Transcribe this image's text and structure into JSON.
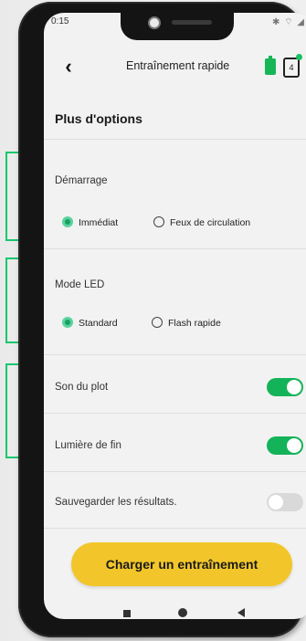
{
  "status_bar": {
    "time": "0:15",
    "icons": "✱ ⌔ ◢"
  },
  "header": {
    "back_icon": "back-chevron-icon",
    "title": "Entraînement rapide",
    "battery_icon": "battery-icon",
    "count": "4",
    "accent": "#16b657"
  },
  "section_title": "Plus d'options",
  "demarrage": {
    "label": "Démarrage",
    "options": [
      "Immédiat",
      "Feux de circulation"
    ],
    "selected": "Immédiat"
  },
  "mode_led": {
    "label": "Mode LED",
    "options": [
      "Standard",
      "Flash rapide"
    ],
    "selected": "Standard"
  },
  "toggles": [
    {
      "label": "Son du plot",
      "on": true
    },
    {
      "label": "Lumière de fin",
      "on": true
    },
    {
      "label": "Sauvegarder les résultats.",
      "on": false
    }
  ],
  "cta": {
    "label": "Charger un entraînement",
    "color": "#f2c62a"
  },
  "nav": {
    "icons": [
      "recents-square-icon",
      "home-circle-icon",
      "back-triangle-icon"
    ]
  },
  "highlight_color": "#18c86e"
}
